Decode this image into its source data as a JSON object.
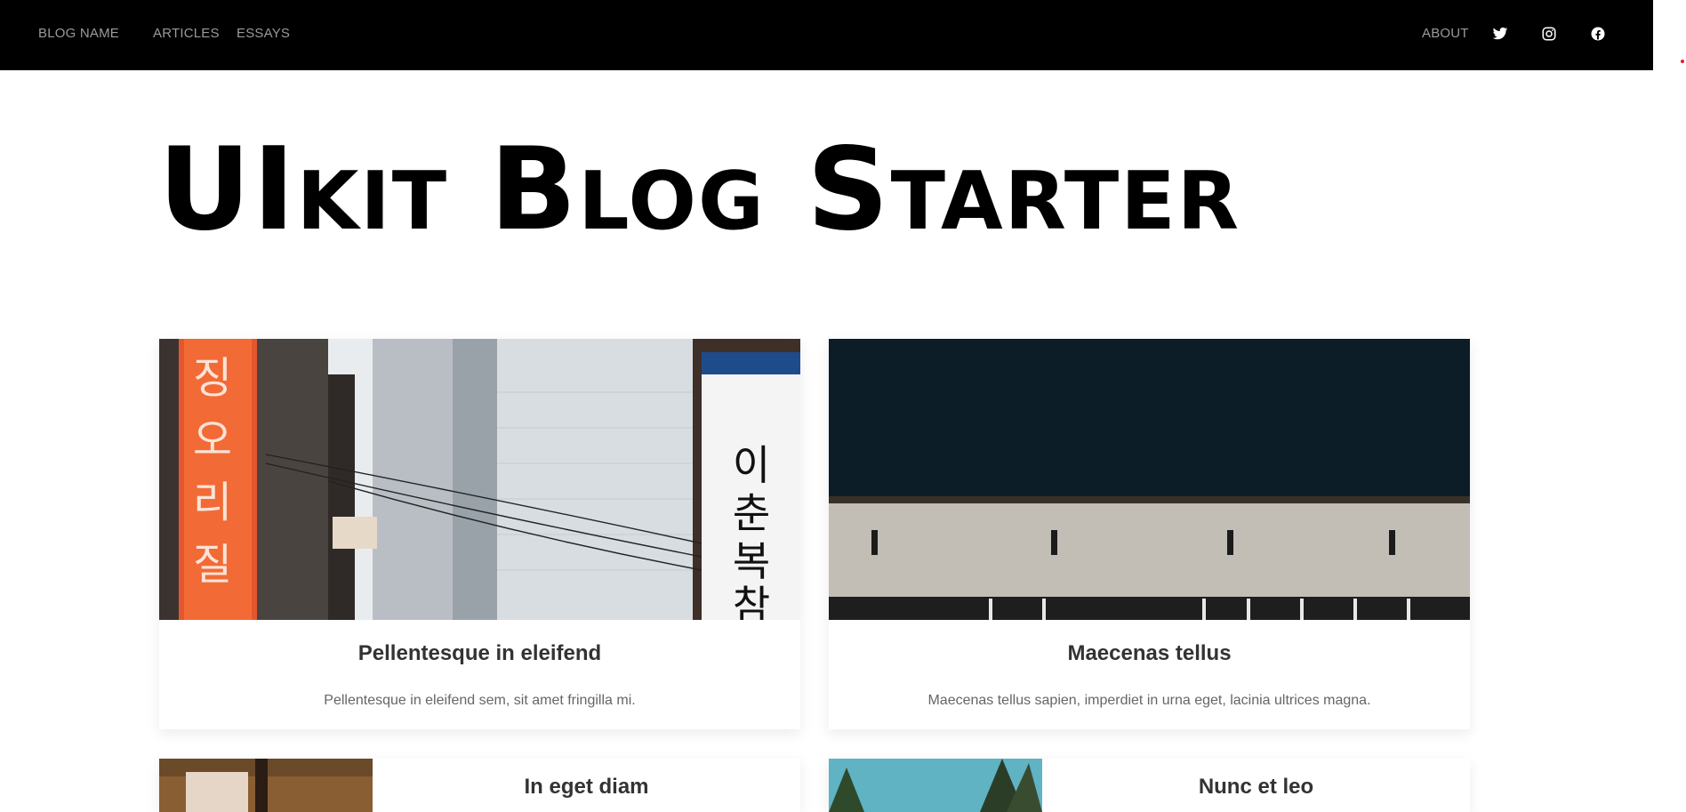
{
  "navbar": {
    "brand": "BLOG NAME",
    "links": [
      "ARTICLES",
      "ESSAYS"
    ],
    "about": "ABOUT",
    "social_icons": [
      "twitter-icon",
      "instagram-icon",
      "facebook-icon"
    ]
  },
  "hero": {
    "title": "UIkit Blog Starter"
  },
  "cards": [
    {
      "title": "Pellentesque in eleifend",
      "text": "Pellentesque in eleifend sem, sit amet fringilla mi.",
      "image": "city-street-korean-signs"
    },
    {
      "title": "Maecenas tellus",
      "text": "Maecenas tellus sapien, imperdiet in urna eget, lacinia ultrices magna.",
      "image": "concrete-building-dark-sky"
    },
    {
      "title": "In eget diam",
      "image": "picnic-blanket-bottle"
    },
    {
      "title": "Nunc et leo",
      "image": "trees-blue-sky"
    }
  ],
  "colors": {
    "navbar_bg": "#000000",
    "nav_text": "#9a9a9a",
    "title": "#000000",
    "accent_dot": "#e5202e"
  }
}
